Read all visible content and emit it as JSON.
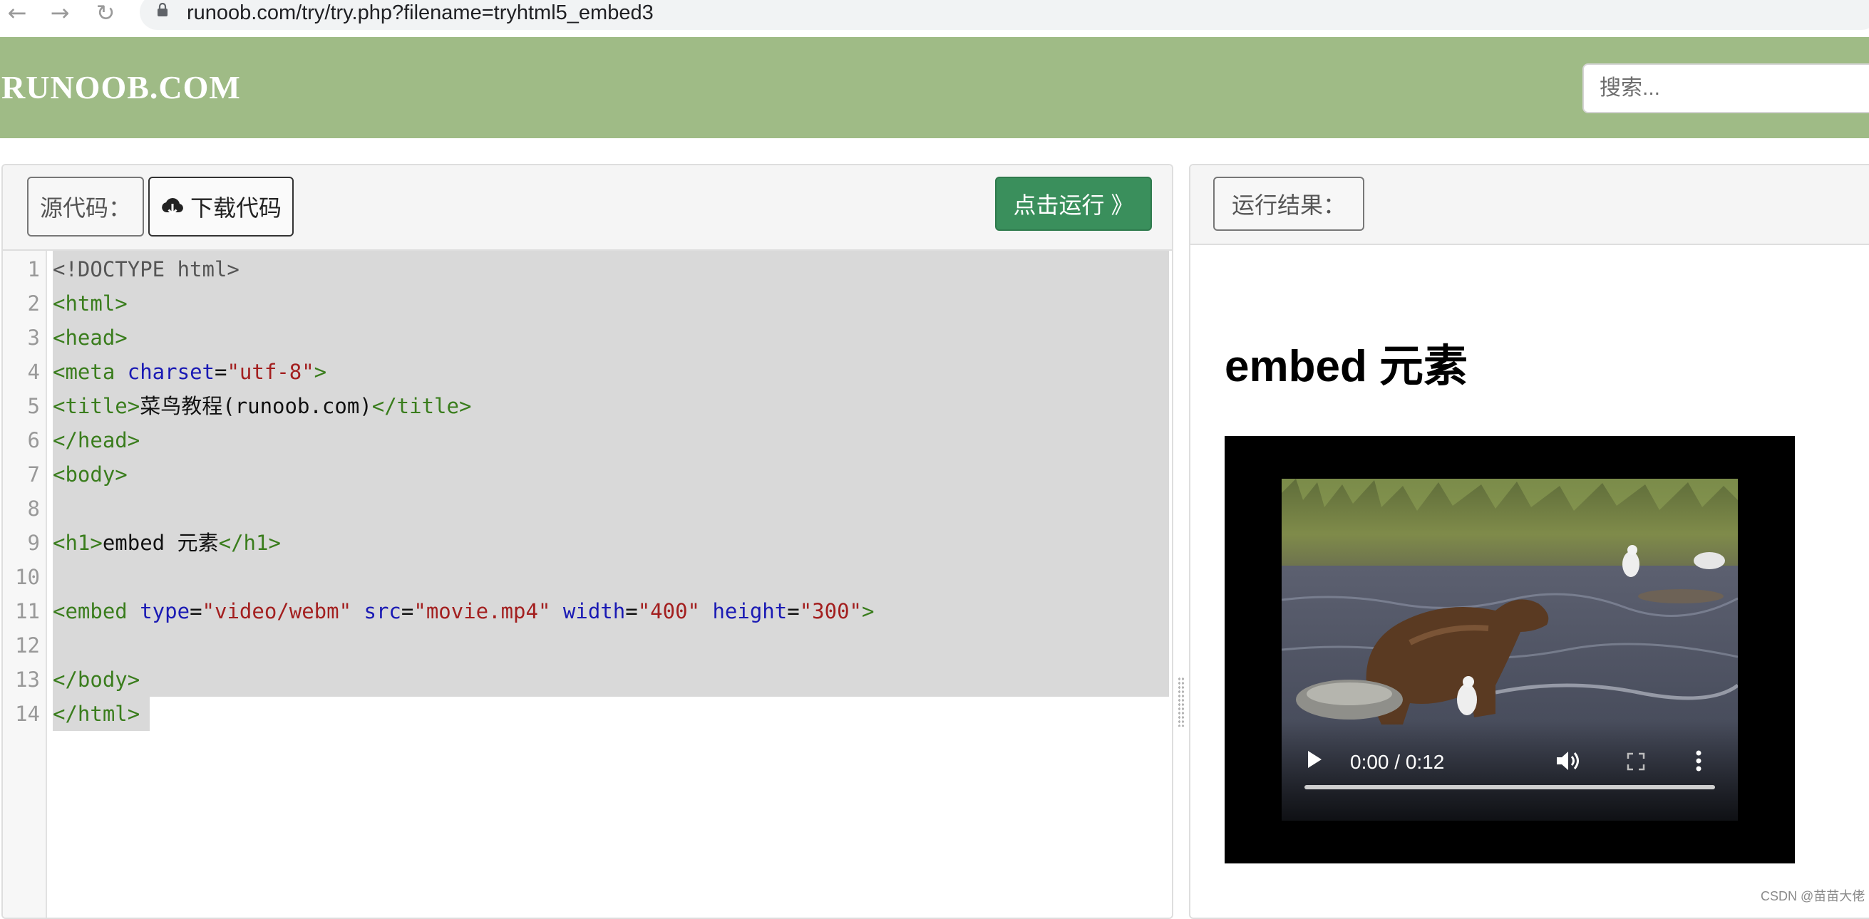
{
  "browser": {
    "url": "runoob.com/try/try.php?filename=tryhtml5_embed3",
    "back_icon": "←",
    "forward_icon": "→",
    "reload_icon": "↻"
  },
  "header": {
    "logo": "RUNOOB.COM",
    "search_placeholder": "搜索..."
  },
  "code_panel": {
    "source_label": "源代码：",
    "download_label": "下载代码",
    "run_label": "点击运行 》",
    "lines": [
      [
        {
          "t": "<!DOCTYPE html>",
          "c": "meta"
        }
      ],
      [
        {
          "t": "<html>",
          "c": "tag"
        }
      ],
      [
        {
          "t": "<head>",
          "c": "tag"
        }
      ],
      [
        {
          "t": "<meta ",
          "c": "tag"
        },
        {
          "t": "charset",
          "c": "attr"
        },
        {
          "t": "=",
          "c": "txt"
        },
        {
          "t": "\"utf-8\"",
          "c": "str"
        },
        {
          "t": ">",
          "c": "tag"
        }
      ],
      [
        {
          "t": "<title>",
          "c": "tag"
        },
        {
          "t": "菜鸟教程(runoob.com)",
          "c": "txt"
        },
        {
          "t": "</title>",
          "c": "tag"
        }
      ],
      [
        {
          "t": "</head>",
          "c": "tag"
        }
      ],
      [
        {
          "t": "<body>",
          "c": "tag"
        }
      ],
      [],
      [
        {
          "t": "<h1>",
          "c": "tag"
        },
        {
          "t": "embed 元素",
          "c": "txt"
        },
        {
          "t": "</h1>",
          "c": "tag"
        }
      ],
      [],
      [
        {
          "t": "<embed ",
          "c": "tag"
        },
        {
          "t": "type",
          "c": "attr"
        },
        {
          "t": "=",
          "c": "txt"
        },
        {
          "t": "\"video/webm\"",
          "c": "str"
        },
        {
          "t": " ",
          "c": "txt"
        },
        {
          "t": "src",
          "c": "attr"
        },
        {
          "t": "=",
          "c": "txt"
        },
        {
          "t": "\"movie.mp4\"",
          "c": "str"
        },
        {
          "t": " ",
          "c": "txt"
        },
        {
          "t": "width",
          "c": "attr"
        },
        {
          "t": "=",
          "c": "txt"
        },
        {
          "t": "\"400\"",
          "c": "str"
        },
        {
          "t": " ",
          "c": "txt"
        },
        {
          "t": "height",
          "c": "attr"
        },
        {
          "t": "=",
          "c": "txt"
        },
        {
          "t": "\"300\"",
          "c": "str"
        },
        {
          "t": ">",
          "c": "tag"
        }
      ],
      [],
      [
        {
          "t": "</body>",
          "c": "tag"
        }
      ],
      [
        {
          "t": "</html>",
          "c": "tag"
        }
      ]
    ]
  },
  "result_panel": {
    "result_label": "运行结果：",
    "heading": "embed 元素",
    "video": {
      "time": "0:00 / 0:12",
      "progress": 0
    }
  },
  "watermark": "CSDN @苗苗大佬",
  "colors": {
    "header_bg": "#9fbb86",
    "run_button": "#3a8f5c",
    "tag": "#3a7d1d",
    "attribute": "#1a1ab4",
    "string": "#a31f1f",
    "selection": "#d9d9d9"
  }
}
